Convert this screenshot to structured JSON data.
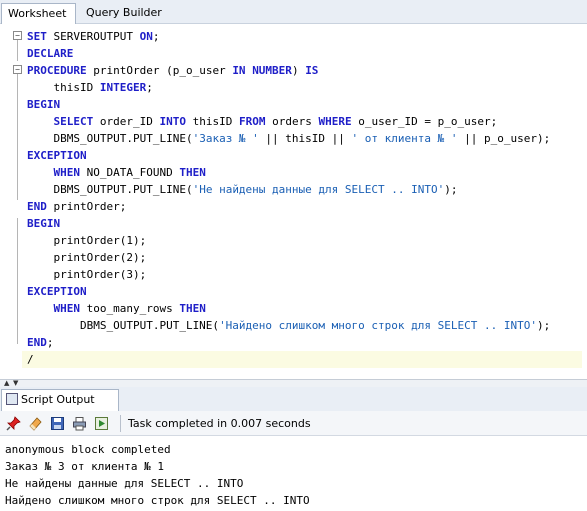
{
  "tabs": [
    {
      "label": "Worksheet",
      "active": true
    },
    {
      "label": "Query Builder",
      "active": false
    }
  ],
  "editor": {
    "lines": [
      [
        {
          "t": "SET",
          "k": "kw"
        },
        {
          "t": " SERVEROUTPUT ",
          "k": ""
        },
        {
          "t": "ON",
          "k": "kw"
        },
        {
          "t": ";",
          "k": ""
        }
      ],
      [
        {
          "t": "DECLARE",
          "k": "kw"
        }
      ],
      [
        {
          "t": "PROCEDURE",
          "k": "kw"
        },
        {
          "t": " printOrder (p_o_user ",
          "k": ""
        },
        {
          "t": "IN",
          "k": "kw"
        },
        {
          "t": " ",
          "k": ""
        },
        {
          "t": "NUMBER",
          "k": "kw"
        },
        {
          "t": ") ",
          "k": ""
        },
        {
          "t": "IS",
          "k": "kw"
        }
      ],
      [
        {
          "t": "    thisID ",
          "k": ""
        },
        {
          "t": "INTEGER",
          "k": "kw"
        },
        {
          "t": ";",
          "k": ""
        }
      ],
      [
        {
          "t": "BEGIN",
          "k": "kw"
        }
      ],
      [
        {
          "t": "    ",
          "k": ""
        },
        {
          "t": "SELECT",
          "k": "kw"
        },
        {
          "t": " order_ID ",
          "k": ""
        },
        {
          "t": "INTO",
          "k": "kw"
        },
        {
          "t": " thisID ",
          "k": ""
        },
        {
          "t": "FROM",
          "k": "kw"
        },
        {
          "t": " orders ",
          "k": ""
        },
        {
          "t": "WHERE",
          "k": "kw"
        },
        {
          "t": " o_user_ID = p_o_user;",
          "k": ""
        }
      ],
      [
        {
          "t": "    DBMS_OUTPUT.PUT_LINE(",
          "k": ""
        },
        {
          "t": "'Заказ № '",
          "k": "str"
        },
        {
          "t": " || thisID || ",
          "k": ""
        },
        {
          "t": "' от клиента № '",
          "k": "str"
        },
        {
          "t": " || p_o_user);",
          "k": ""
        }
      ],
      [
        {
          "t": "EXCEPTION",
          "k": "kw"
        }
      ],
      [
        {
          "t": "    ",
          "k": ""
        },
        {
          "t": "WHEN",
          "k": "kw"
        },
        {
          "t": " NO_DATA_FOUND ",
          "k": ""
        },
        {
          "t": "THEN",
          "k": "kw"
        }
      ],
      [
        {
          "t": "    DBMS_OUTPUT.PUT_LINE(",
          "k": ""
        },
        {
          "t": "'Не найдены данные для SELECT .. INTO'",
          "k": "str"
        },
        {
          "t": ");",
          "k": ""
        }
      ],
      [
        {
          "t": "END",
          "k": "kw"
        },
        {
          "t": " printOrder;",
          "k": ""
        }
      ],
      [
        {
          "t": "BEGIN",
          "k": "kw"
        }
      ],
      [
        {
          "t": "    printOrder(1);",
          "k": ""
        }
      ],
      [
        {
          "t": "    printOrder(2);",
          "k": ""
        }
      ],
      [
        {
          "t": "    printOrder(3);",
          "k": ""
        }
      ],
      [
        {
          "t": "EXCEPTION",
          "k": "kw"
        }
      ],
      [
        {
          "t": "    ",
          "k": ""
        },
        {
          "t": "WHEN",
          "k": "kw"
        },
        {
          "t": " too_many_rows ",
          "k": ""
        },
        {
          "t": "THEN",
          "k": "kw"
        }
      ],
      [
        {
          "t": "        DBMS_OUTPUT.PUT_LINE(",
          "k": ""
        },
        {
          "t": "'Найдено слишком много строк для SELECT .. INTO'",
          "k": "str"
        },
        {
          "t": ");",
          "k": ""
        }
      ],
      [
        {
          "t": "END",
          "k": "kw"
        },
        {
          "t": ";",
          "k": ""
        }
      ],
      [
        {
          "t": "/",
          "k": ""
        }
      ]
    ],
    "current_line": 19
  },
  "output_panel": {
    "tab_label": "Script Output",
    "toolbar_icons": [
      "pin-icon",
      "eraser-icon",
      "save-icon",
      "print-icon",
      "run-script-icon"
    ],
    "status": "Task completed in 0.007 seconds",
    "lines": [
      "anonymous block completed",
      "Заказ № 3 от клиента № 1",
      "Не найдены данные для SELECT .. INTO",
      "Найдено слишком много строк для SELECT .. INTO"
    ]
  },
  "colors": {
    "keyword": "#1e1ec8",
    "string": "#1a5fb4",
    "current_line_bg": "#fbfbe2",
    "tabbar_bg": "#e9eef5"
  }
}
